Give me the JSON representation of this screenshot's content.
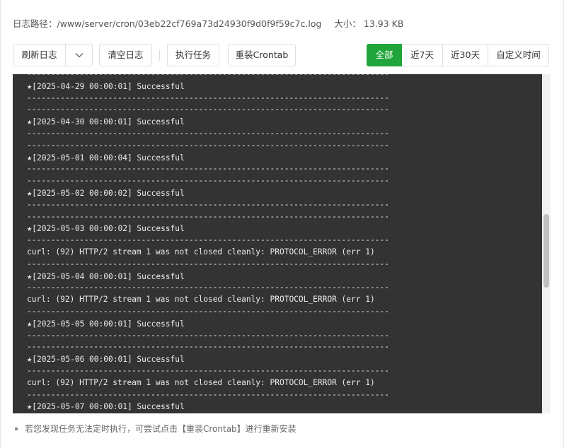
{
  "file_info": {
    "path_label": "日志路径：",
    "path_value": "/www/server/cron/03eb22cf769a73d24930f9d0f9f59c7c.log",
    "size_label": "大小：",
    "size_value": "13.93 KB"
  },
  "toolbar": {
    "refresh_label": "刷新日志",
    "clear_label": "清空日志",
    "run_label": "执行任务",
    "reinstall_label": "重装Crontab",
    "range_options": [
      "全部",
      "近7天",
      "近30天",
      "自定义时间"
    ],
    "range_selected": "全部"
  },
  "colors": {
    "accent": "#20a53a",
    "log_background": "#333333",
    "log_text": "#ececec"
  },
  "log": {
    "separator": "----------------------------------------------------------------------------",
    "lines": [
      {
        "kind": "sep"
      },
      {
        "kind": "entry",
        "text": "[2025-04-29 00:00:01] Successful"
      },
      {
        "kind": "sep"
      },
      {
        "kind": "sep"
      },
      {
        "kind": "entry",
        "text": "[2025-04-30 00:00:01] Successful"
      },
      {
        "kind": "sep"
      },
      {
        "kind": "sep"
      },
      {
        "kind": "entry",
        "text": "[2025-05-01 00:00:04] Successful"
      },
      {
        "kind": "sep"
      },
      {
        "kind": "sep"
      },
      {
        "kind": "entry",
        "text": "[2025-05-02 00:00:02] Successful"
      },
      {
        "kind": "sep"
      },
      {
        "kind": "sep"
      },
      {
        "kind": "entry",
        "text": "[2025-05-03 00:00:02] Successful"
      },
      {
        "kind": "sep"
      },
      {
        "kind": "text",
        "text": "curl: (92) HTTP/2 stream 1 was not closed cleanly: PROTOCOL_ERROR (err 1)"
      },
      {
        "kind": "sep"
      },
      {
        "kind": "entry",
        "text": "[2025-05-04 00:00:01] Successful"
      },
      {
        "kind": "sep"
      },
      {
        "kind": "text",
        "text": "curl: (92) HTTP/2 stream 1 was not closed cleanly: PROTOCOL_ERROR (err 1)"
      },
      {
        "kind": "sep"
      },
      {
        "kind": "entry",
        "text": "[2025-05-05 00:00:01] Successful"
      },
      {
        "kind": "sep"
      },
      {
        "kind": "sep"
      },
      {
        "kind": "entry",
        "text": "[2025-05-06 00:00:01] Successful"
      },
      {
        "kind": "sep"
      },
      {
        "kind": "text",
        "text": "curl: (92) HTTP/2 stream 1 was not closed cleanly: PROTOCOL_ERROR (err 1)"
      },
      {
        "kind": "sep"
      },
      {
        "kind": "entry",
        "text": "[2025-05-07 00:00:01] Successful"
      }
    ]
  },
  "tip": {
    "text": "若您发现任务无法定时执行，可尝试点击【重装Crontab】进行重新安装"
  }
}
